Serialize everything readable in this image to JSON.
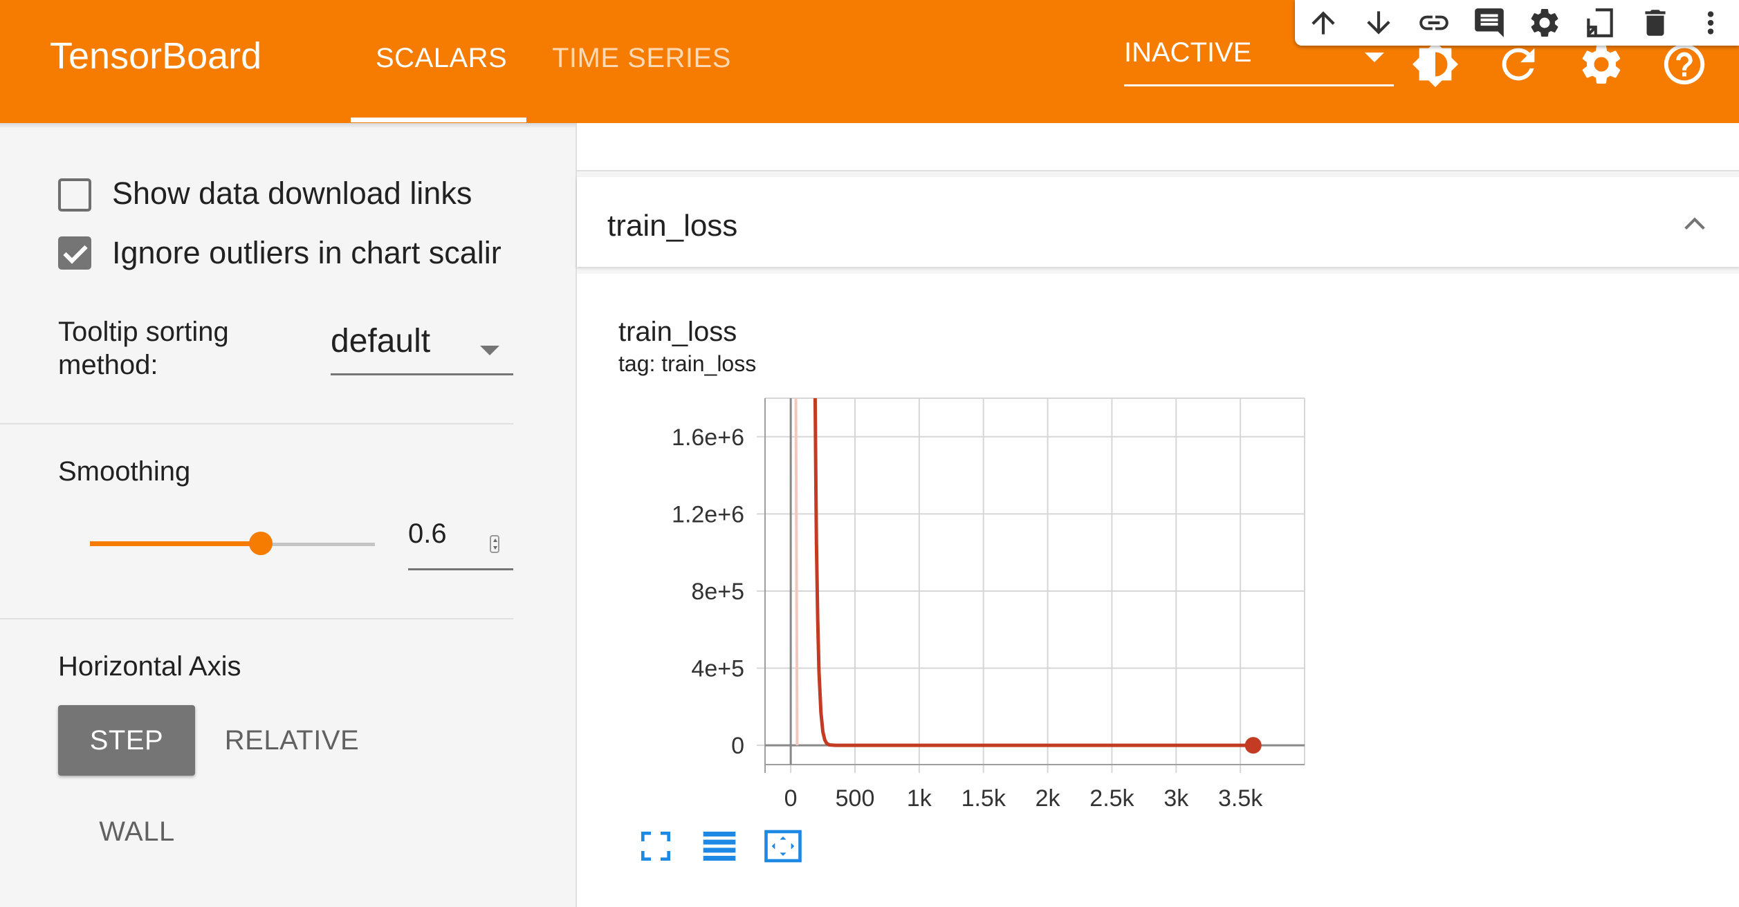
{
  "header": {
    "brand": "TensorBoard",
    "tabs": [
      {
        "label": "SCALARS",
        "active": true
      },
      {
        "label": "TIME SERIES",
        "active": false
      }
    ],
    "run_select": "INACTIVE",
    "icons": [
      "theme-icon",
      "refresh-icon",
      "settings-icon",
      "help-icon"
    ]
  },
  "floating_toolbar": {
    "icons": [
      "arrow-up-icon",
      "arrow-down-icon",
      "link-icon",
      "comment-icon",
      "settings-icon",
      "open-in-new-icon",
      "delete-icon",
      "more-vert-icon"
    ]
  },
  "sidebar": {
    "show_download_links": {
      "label": "Show data download links",
      "checked": false
    },
    "ignore_outliers": {
      "label": "Ignore outliers in chart scalir",
      "checked": true
    },
    "tooltip_sorting": {
      "label_line1": "Tooltip sorting",
      "label_line2": "method:",
      "value": "default"
    },
    "smoothing": {
      "label": "Smoothing",
      "value": "0.6",
      "fraction": 0.6
    },
    "horizontal_axis": {
      "label": "Horizontal Axis",
      "options": [
        "STEP",
        "RELATIVE",
        "WALL"
      ],
      "selected": "STEP"
    }
  },
  "main": {
    "section_title": "train_loss",
    "chart_title": "train_loss",
    "chart_tag": "tag: train_loss"
  },
  "chart_data": {
    "type": "line",
    "xlim": [
      -200,
      4000
    ],
    "ylim": [
      -100000,
      1800000
    ],
    "x_ticks": [
      0,
      500,
      1000,
      1500,
      2000,
      2500,
      3000,
      3500
    ],
    "x_tick_labels": [
      "0",
      "500",
      "1k",
      "1.5k",
      "2k",
      "2.5k",
      "3k",
      "3.5k"
    ],
    "y_ticks": [
      0,
      400000,
      800000,
      1200000,
      1600000
    ],
    "y_tick_labels": [
      "0",
      "4e+5",
      "8e+5",
      "1.2e+6",
      "1.6e+6"
    ],
    "grid": true,
    "series": [
      {
        "color": "#c23b22",
        "x": [
          190,
          195,
          200,
          210,
          220,
          235,
          250,
          265,
          280,
          300,
          350,
          3600
        ],
        "y": [
          1800000,
          1400000,
          1050000,
          650000,
          380000,
          170000,
          70000,
          28000,
          10000,
          2000,
          0,
          0
        ]
      }
    ],
    "raw_series_color": "#f4c7bd",
    "raw_x": [
      40,
      45,
      50
    ],
    "raw_y": [
      1800000,
      900000,
      0
    ],
    "last_point": {
      "x": 3600,
      "y": 0
    }
  }
}
